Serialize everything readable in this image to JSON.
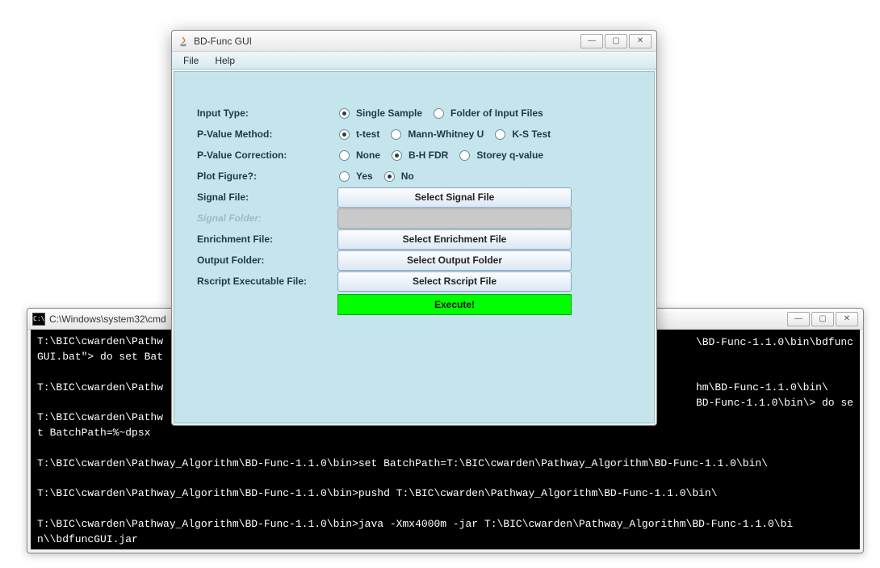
{
  "cmd": {
    "title": "C:\\Windows\\system32\\cmd",
    "body": "T:\\BIC\\cwarden\\Pathw\nGUI.bat\"> do set Bat\n\nT:\\BIC\\cwarden\\Pathw\n\nT:\\BIC\\cwarden\\Pathw\nt BatchPath=%~dpsx\n\nT:\\BIC\\cwarden\\Pathway_Algorithm\\BD-Func-1.1.0\\bin>set BatchPath=T:\\BIC\\cwarden\\Pathway_Algorithm\\BD-Func-1.1.0\\bin\\\n\nT:\\BIC\\cwarden\\Pathway_Algorithm\\BD-Func-1.1.0\\bin>pushd T:\\BIC\\cwarden\\Pathway_Algorithm\\BD-Func-1.1.0\\bin\\\n\nT:\\BIC\\cwarden\\Pathway_Algorithm\\BD-Func-1.1.0\\bin>java -Xmx4000m -jar T:\\BIC\\cwarden\\Pathway_Algorithm\\BD-Func-1.1.0\\bi\nn\\\\bdfuncGUI.jar",
    "overlay1": "\\BD-Func-1.1.0\\bin\\bdfunc",
    "overlay2": "hm\\BD-Func-1.1.0\\bin\\",
    "overlay3": "BD-Func-1.1.0\\bin\\> do se"
  },
  "gui": {
    "title": "BD-Func GUI",
    "menus": {
      "file": "File",
      "help": "Help"
    },
    "labels": {
      "inputType": "Input Type:",
      "pvalMethod": "P-Value Method:",
      "pvalCorrection": "P-Value Correction:",
      "plotFigure": "Plot Figure?:",
      "signalFile": "Signal File:",
      "sigFolder": "Signal Folder:",
      "enrichFile": "Enrichment File:",
      "outputFolder": "Output Folder:",
      "rscriptFile": "Rscript Executable File:"
    },
    "options": {
      "inputType": {
        "single": "Single Sample",
        "folder": "Folder of Input Files"
      },
      "pvalMethod": {
        "ttest": "t-test",
        "mw": "Mann-Whitney U",
        "ks": "K-S Test"
      },
      "pvalCorrection": {
        "none": "None",
        "bh": "B-H FDR",
        "storey": "Storey q-value"
      },
      "plotFigure": {
        "yes": "Yes",
        "no": "No"
      }
    },
    "buttons": {
      "selectSignal": "Select Signal File",
      "selectEnrich": "Select Enrichment File",
      "selectOutput": "Select Output Folder",
      "selectRscript": "Select Rscript File",
      "execute": "Execute!"
    },
    "selected": {
      "inputType": "single",
      "pvalMethod": "ttest",
      "pvalCorrection": "bh",
      "plotFigure": "no"
    }
  }
}
